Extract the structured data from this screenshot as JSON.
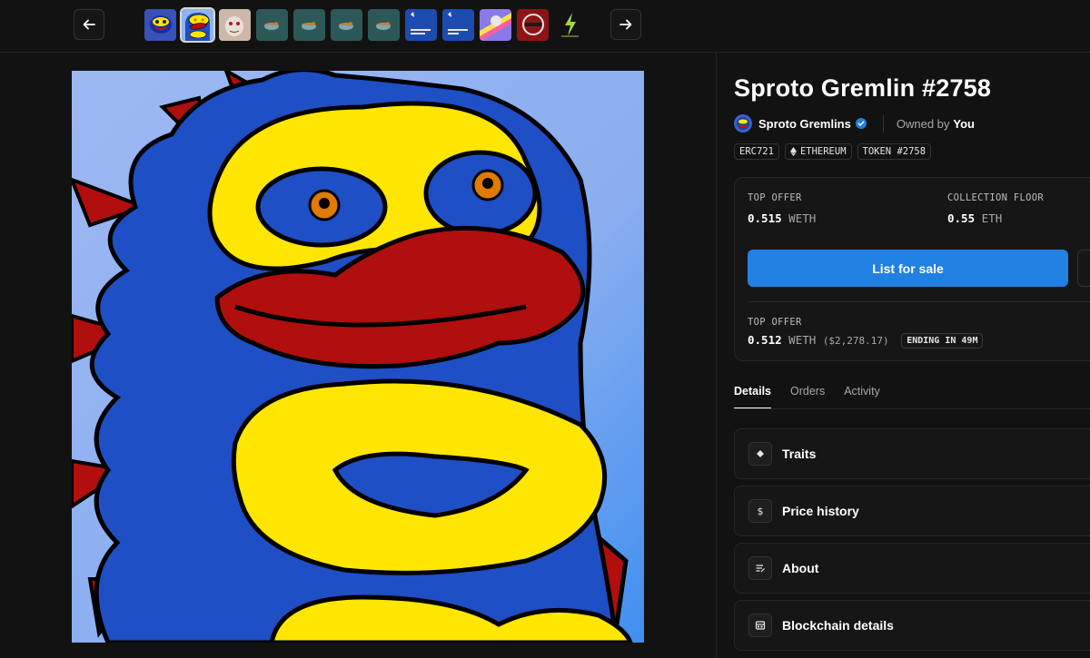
{
  "nav": {
    "prev_icon": "arrow-left-icon",
    "next_icon": "arrow-right-icon",
    "thumbnails": [
      {
        "name": "thumb-1",
        "bg": "#2b3f8f"
      },
      {
        "name": "thumb-2",
        "bg": "#f0d000",
        "selected": true
      },
      {
        "name": "thumb-3",
        "bg": "#b89a8c"
      },
      {
        "name": "thumb-4",
        "bg": "#2f5a5a"
      },
      {
        "name": "thumb-5",
        "bg": "#2f5a5a"
      },
      {
        "name": "thumb-6",
        "bg": "#2f5a5a"
      },
      {
        "name": "thumb-7",
        "bg": "#2f5a5a"
      },
      {
        "name": "thumb-8",
        "bg": "#1c4cb0"
      },
      {
        "name": "thumb-9",
        "bg": "#1c4cb0"
      },
      {
        "name": "thumb-10",
        "bg": "#7a6ae0"
      },
      {
        "name": "thumb-11",
        "bg": "#9e1a1a"
      },
      {
        "name": "thumb-12",
        "bg": "#141414"
      }
    ]
  },
  "item": {
    "title": "Sproto Gremlin #2758",
    "collection": "Sproto Gremlins",
    "owned_label": "Owned by",
    "owner": "You",
    "badges": {
      "standard": "ERC721",
      "chain": "ETHEREUM",
      "token": "TOKEN #2758"
    }
  },
  "offers": {
    "top_offer_label": "TOP OFFER",
    "top_offer_amount": "0.515",
    "top_offer_unit": "WETH",
    "floor_label": "COLLECTION FLOOR",
    "floor_amount": "0.55",
    "floor_unit": "ETH",
    "list_button": "List for sale",
    "second_offer_label": "TOP OFFER",
    "second_offer_amount": "0.512",
    "second_offer_unit": "WETH",
    "second_offer_usd": "($2,278.17)",
    "ending": "ENDING IN 49M"
  },
  "tabs": [
    "Details",
    "Orders",
    "Activity"
  ],
  "sections": [
    {
      "label": "Traits",
      "icon": "diamond-icon"
    },
    {
      "label": "Price history",
      "icon": "dollar-icon"
    },
    {
      "label": "About",
      "icon": "description-icon"
    },
    {
      "label": "Blockchain details",
      "icon": "blockchain-icon"
    }
  ],
  "colors": {
    "accent": "#2081e2",
    "background": "#121212",
    "card": "#161616",
    "artwork_blue": "#1f4fc4",
    "artwork_yellow": "#ffe600",
    "artwork_red": "#b10e0e"
  }
}
